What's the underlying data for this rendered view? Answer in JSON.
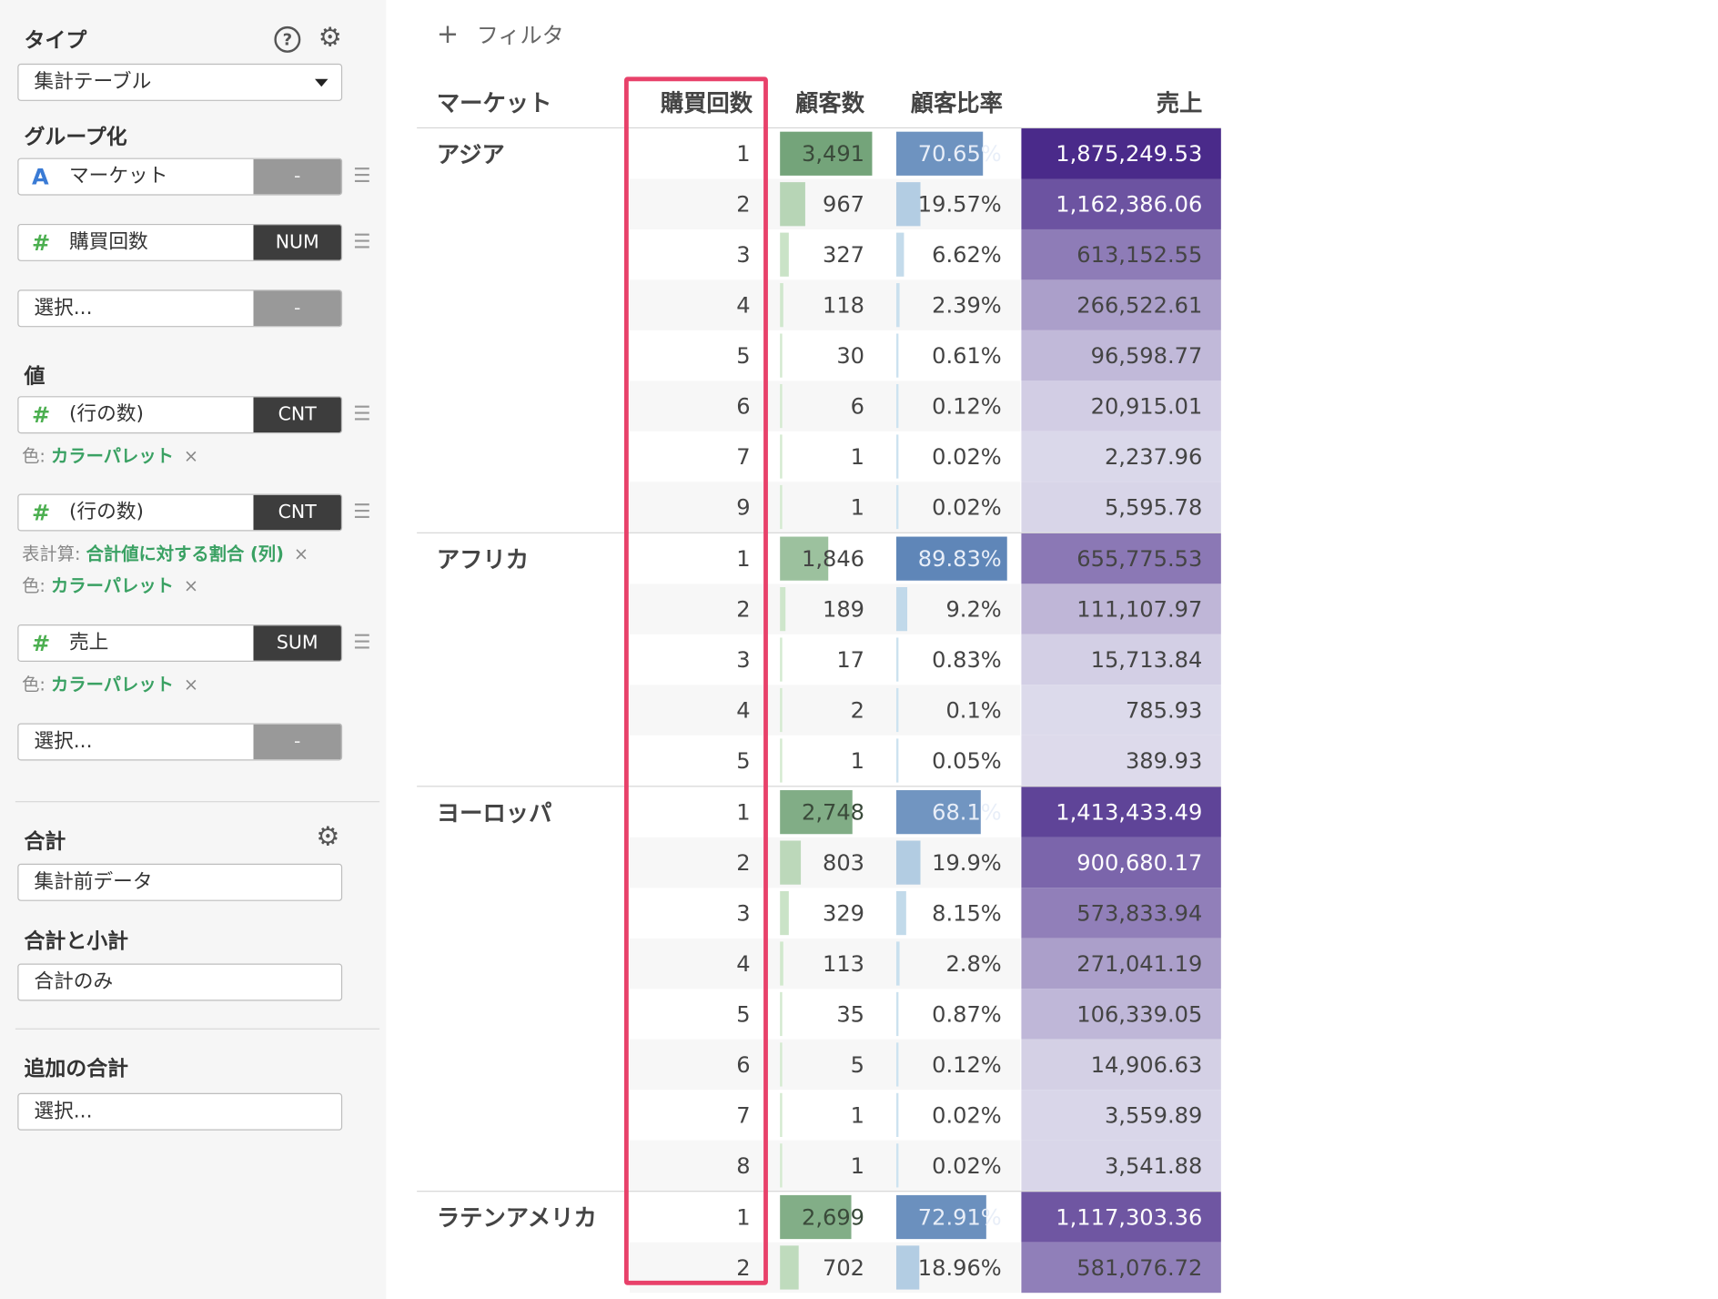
{
  "sidebar": {
    "type_title": "タイプ",
    "type_value": "集計テーブル",
    "group_title": "グループ化",
    "group_fields": [
      {
        "type": "A",
        "name": "マーケット",
        "agg": "-"
      },
      {
        "type": "#",
        "name": "購買回数",
        "agg": "NUM"
      },
      {
        "type": "",
        "name": "選択...",
        "agg": "-"
      }
    ],
    "value_title": "値",
    "value_fields": [
      {
        "type": "#",
        "name": "(行の数)",
        "agg": "CNT"
      },
      {
        "type": "#",
        "name": "(行の数)",
        "agg": "CNT"
      },
      {
        "type": "#",
        "name": "売上",
        "agg": "SUM"
      },
      {
        "type": "",
        "name": "選択...",
        "agg": "-"
      }
    ],
    "color_label": "色:",
    "color_value": "カラーパレット",
    "calc_label": "表計算:",
    "calc_value": "合計値に対する割合 (列)",
    "remove_glyph": "×",
    "total_title": "合計",
    "total_value": "集計前データ",
    "subtotal_title": "合計と小計",
    "subtotal_value": "合計のみ",
    "extra_title": "追加の合計",
    "extra_value": "選択..."
  },
  "main": {
    "filter_plus": "+",
    "filter_label": "フィルタ",
    "headers": {
      "market": "マーケット",
      "purchases": "購買回数",
      "customers": "顧客数",
      "ratio": "顧客比率",
      "sales": "売上"
    }
  },
  "table": {
    "groups": [
      {
        "market": "アジア",
        "rows": [
          {
            "p": "1",
            "c": "3,491",
            "r": "70.65%",
            "s": "1,875,249.53"
          },
          {
            "p": "2",
            "c": "967",
            "r": "19.57%",
            "s": "1,162,386.06"
          },
          {
            "p": "3",
            "c": "327",
            "r": "6.62%",
            "s": "613,152.55"
          },
          {
            "p": "4",
            "c": "118",
            "r": "2.39%",
            "s": "266,522.61"
          },
          {
            "p": "5",
            "c": "30",
            "r": "0.61%",
            "s": "96,598.77"
          },
          {
            "p": "6",
            "c": "6",
            "r": "0.12%",
            "s": "20,915.01"
          },
          {
            "p": "7",
            "c": "1",
            "r": "0.02%",
            "s": "2,237.96"
          },
          {
            "p": "9",
            "c": "1",
            "r": "0.02%",
            "s": "5,595.78"
          }
        ]
      },
      {
        "market": "アフリカ",
        "rows": [
          {
            "p": "1",
            "c": "1,846",
            "r": "89.83%",
            "s": "655,775.53"
          },
          {
            "p": "2",
            "c": "189",
            "r": "9.2%",
            "s": "111,107.97"
          },
          {
            "p": "3",
            "c": "17",
            "r": "0.83%",
            "s": "15,713.84"
          },
          {
            "p": "4",
            "c": "2",
            "r": "0.1%",
            "s": "785.93"
          },
          {
            "p": "5",
            "c": "1",
            "r": "0.05%",
            "s": "389.93"
          }
        ]
      },
      {
        "market": "ヨーロッパ",
        "rows": [
          {
            "p": "1",
            "c": "2,748",
            "r": "68.1%",
            "s": "1,413,433.49"
          },
          {
            "p": "2",
            "c": "803",
            "r": "19.9%",
            "s": "900,680.17"
          },
          {
            "p": "3",
            "c": "329",
            "r": "8.15%",
            "s": "573,833.94"
          },
          {
            "p": "4",
            "c": "113",
            "r": "2.8%",
            "s": "271,041.19"
          },
          {
            "p": "5",
            "c": "35",
            "r": "0.87%",
            "s": "106,339.05"
          },
          {
            "p": "6",
            "c": "5",
            "r": "0.12%",
            "s": "14,906.63"
          },
          {
            "p": "7",
            "c": "1",
            "r": "0.02%",
            "s": "3,559.89"
          },
          {
            "p": "8",
            "c": "1",
            "r": "0.02%",
            "s": "3,541.88"
          }
        ]
      },
      {
        "market": "ラテンアメリカ",
        "rows": [
          {
            "p": "1",
            "c": "2,699",
            "r": "72.91%",
            "s": "1,117,303.36"
          },
          {
            "p": "2",
            "c": "702",
            "r": "18.96%",
            "s": "581,076.72"
          }
        ]
      }
    ]
  },
  "colors": {
    "highlight": "#e8416a",
    "accent_green": "#3aa163",
    "sales_dark": "#4a2a8a",
    "sales_light": "#dedcec"
  }
}
